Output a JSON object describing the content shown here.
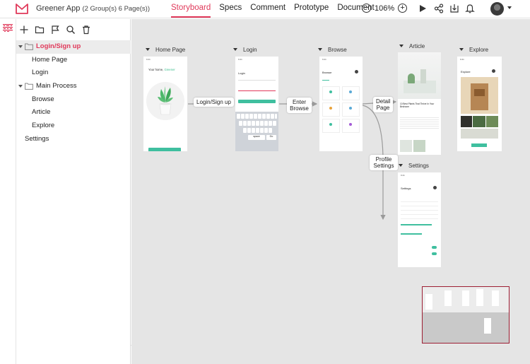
{
  "app": {
    "title": "Greener App",
    "subtitle": "(2 Group(s) 6 Page(s))",
    "brand_color": "#e0395a"
  },
  "tabs": [
    {
      "label": "Storyboard",
      "active": true
    },
    {
      "label": "Specs",
      "active": false
    },
    {
      "label": "Comment",
      "active": false
    },
    {
      "label": "Prototype",
      "active": false
    },
    {
      "label": "Document",
      "active": false
    }
  ],
  "zoom": {
    "value": "106%"
  },
  "toolbar_icons": [
    "play-icon",
    "share-icon",
    "download-icon",
    "bell-icon",
    "avatar",
    "chevron-down-icon"
  ],
  "sidebar": {
    "tools": [
      "plus-icon",
      "folder-icon",
      "flag-icon",
      "search-icon",
      "trash-icon"
    ],
    "tree": [
      {
        "label": "Login/Sign up",
        "type": "group",
        "selected": true
      },
      {
        "label": "Home Page",
        "type": "child"
      },
      {
        "label": "Login",
        "type": "child"
      },
      {
        "label": "Main Process",
        "type": "group",
        "selected": false
      },
      {
        "label": "Browse",
        "type": "child"
      },
      {
        "label": "Article",
        "type": "child"
      },
      {
        "label": "Explore",
        "type": "child"
      },
      {
        "label": "Settings",
        "type": "root"
      }
    ]
  },
  "canvas": {
    "screens": [
      {
        "name": "Home Page"
      },
      {
        "name": "Login"
      },
      {
        "name": "Browse"
      },
      {
        "name": "Article"
      },
      {
        "name": "Explore"
      },
      {
        "name": "Settings"
      }
    ],
    "links": [
      {
        "label": "Login/Sign up"
      },
      {
        "label": "Enter Browse"
      },
      {
        "label": "Detail Page"
      },
      {
        "label": "Profile Settings"
      }
    ],
    "mockup_text": {
      "home_headline_1": "Your home,",
      "home_headline_2": "Greener",
      "browse_title": "Browse",
      "article_title": "10 Best Plants That Thrive In Your Bedroom",
      "explore_title": "Explore",
      "settings_title": "Settings",
      "login_title": "Login",
      "keyboard_rows": [
        "Q W E R T Y U I O P",
        "A S D F G H J K L",
        "Z X C V B N M"
      ],
      "kb_space": "space",
      "kb_go": "Go"
    }
  }
}
